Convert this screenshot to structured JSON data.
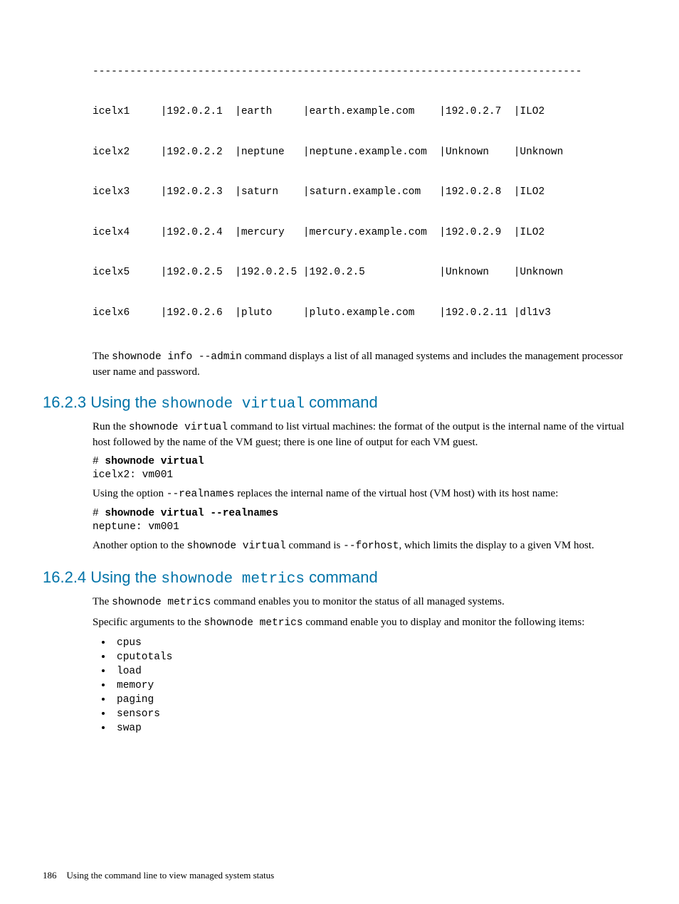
{
  "table": {
    "divider": "-------------------------------------------------------------------------------",
    "lines": [
      "icelx1     |192.0.2.1  |earth     |earth.example.com    |192.0.2.7  |ILO2",
      "icelx2     |192.0.2.2  |neptune   |neptune.example.com  |Unknown    |Unknown",
      "icelx3     |192.0.2.3  |saturn    |saturn.example.com   |192.0.2.8  |ILO2",
      "icelx4     |192.0.2.4  |mercury   |mercury.example.com  |192.0.2.9  |ILO2",
      "icelx5     |192.0.2.5  |192.0.2.5 |192.0.2.5            |Unknown    |Unknown",
      "icelx6     |192.0.2.6  |pluto     |pluto.example.com    |192.0.2.11 |dl1v3"
    ]
  },
  "para_after_table_pre": "The ",
  "para_after_table_code": "shownode info --admin",
  "para_after_table_post": " command displays a list of all managed systems and includes the management processor user name and password.",
  "sec1623": {
    "num": "16.2.3 Using the ",
    "code": "shownode virtual",
    "suffix": " command",
    "p1_a": "Run the ",
    "p1_code": "shownode virtual",
    "p1_b": " command to list virtual machines: the format of the output is the internal name of the virtual host followed by the name of the VM guest; there is one line of output for each VM guest.",
    "code1_prompt": "# ",
    "code1_cmd": "shownode virtual",
    "code1_out": "icelx2: vm001",
    "p2_a": "Using the option ",
    "p2_code": "--realnames",
    "p2_b": " replaces the internal name of the virtual host (VM host) with its host name:",
    "code2_prompt": "# ",
    "code2_cmd": "shownode virtual --realnames",
    "code2_out": "neptune: vm001",
    "p3_a": "Another option to the ",
    "p3_code1": "shownode virtual",
    "p3_b": " command is ",
    "p3_code2": "--forhost",
    "p3_c": ", which limits the display to a given VM host."
  },
  "sec1624": {
    "num": "16.2.4 Using the ",
    "code": "shownode metrics",
    "suffix": " command",
    "p1_a": "The ",
    "p1_code": "shownode metrics",
    "p1_b": " command enables you to monitor the status of all managed systems.",
    "p2_a": "Specific arguments to the ",
    "p2_code": "shownode metrics",
    "p2_b": " command enable you to display and monitor the following items:",
    "items": [
      "cpus",
      "cputotals",
      "load",
      "memory",
      "paging",
      "sensors",
      "swap"
    ]
  },
  "footer": {
    "page": "186",
    "title": "Using the command line to view managed system status"
  }
}
